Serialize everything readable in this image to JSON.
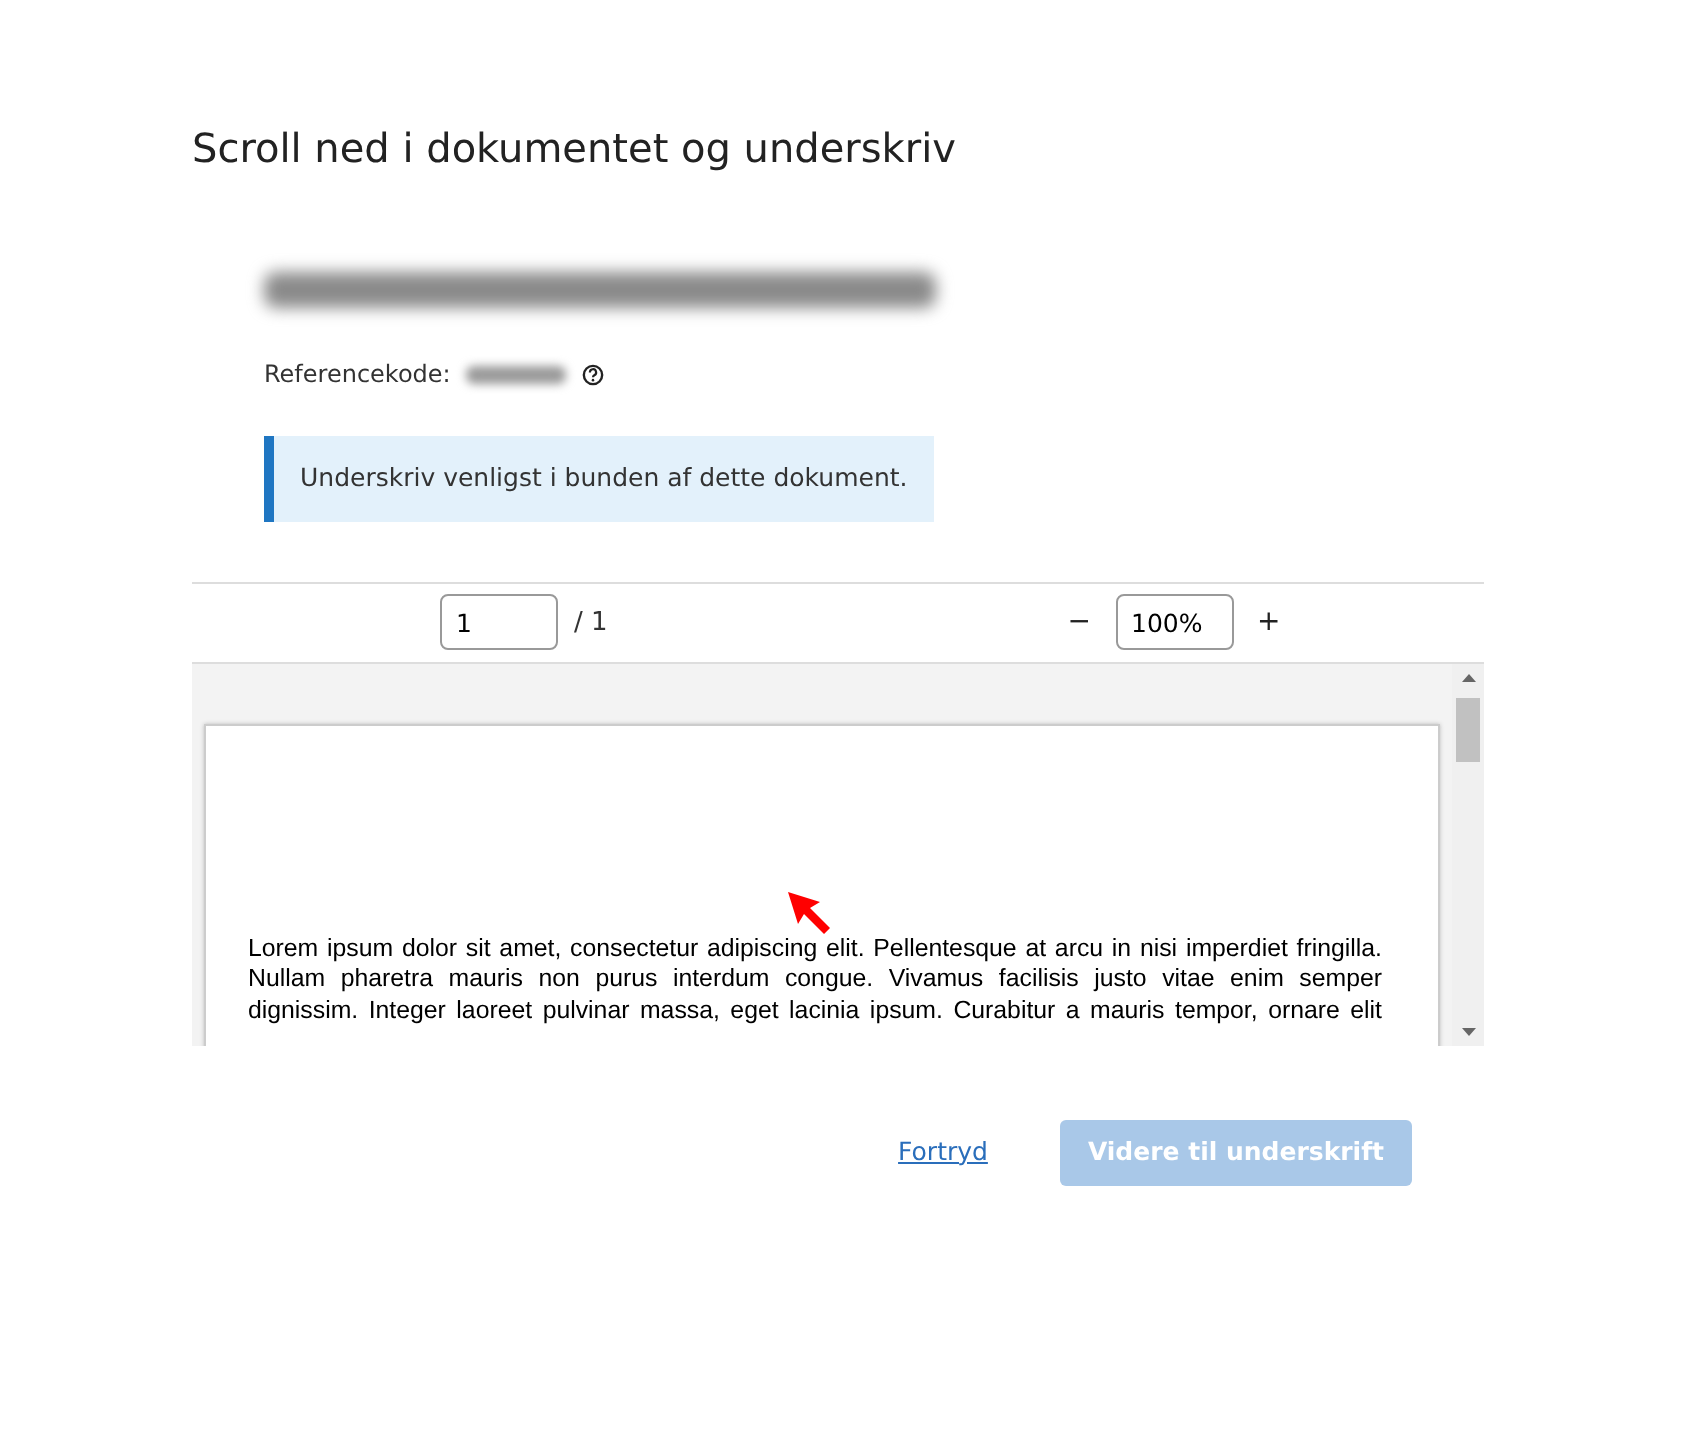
{
  "heading": "Scroll ned i dokumentet og underskriv",
  "document_title": {
    "redacted": true
  },
  "reference": {
    "label": "Referencekode:",
    "redacted": true
  },
  "notice": "Underskriv venligst i bunden af dette dokument.",
  "toolbar": {
    "page_value": "1",
    "page_total": "/ 1",
    "zoom_out": "−",
    "zoom_value": "100%",
    "zoom_in": "+"
  },
  "document_text": "Lorem ipsum dolor sit amet, consectetur adipiscing elit. Pellentesque at arcu in nisi imperdiet fringilla. Nullam pharetra mauris non purus interdum congue. Vivamus facilisis justo vitae enim semper dignissim. Integer laoreet pulvinar massa, eget lacinia ipsum. Curabitur a mauris tempor, ornare elit",
  "actions": {
    "cancel": "Fortryd",
    "proceed": {
      "label": "Videre til underskrift",
      "disabled": true
    }
  }
}
